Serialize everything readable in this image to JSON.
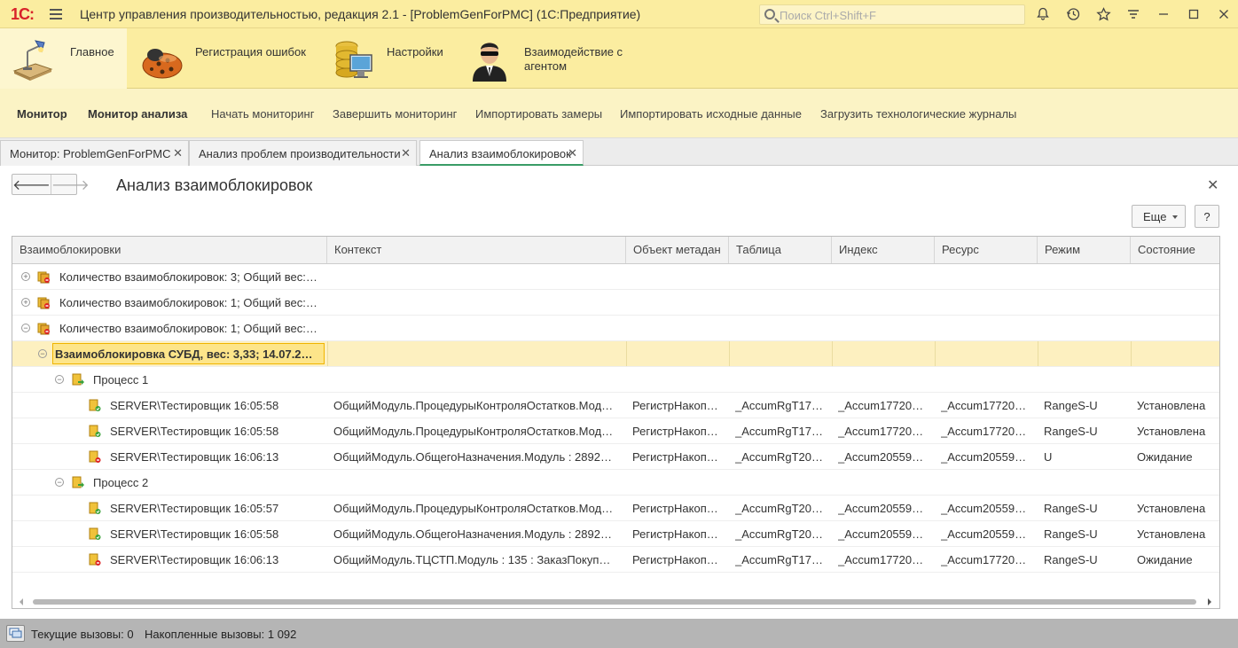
{
  "titlebar": {
    "logo": "1С:",
    "title": "Центр управления производительностью, редакция 2.1 - [ProblemGenForPMC]  (1С:Предприятие)",
    "search_placeholder": "Поиск Ctrl+Shift+F"
  },
  "sections": [
    {
      "label": "Главное",
      "icon": "desk-lamp-icon"
    },
    {
      "label": "Регистрация ошибок",
      "icon": "ladybug-icon"
    },
    {
      "label": "Настройки",
      "icon": "database-monitor-icon"
    },
    {
      "label": "Взаимодействие с агентом",
      "icon": "agent-icon"
    }
  ],
  "functions": [
    {
      "label": "Монитор",
      "bold": true
    },
    {
      "label": "Монитор анализа",
      "bold": true
    },
    {
      "label": "Начать мониторинг",
      "bold": false
    },
    {
      "label": "Завершить мониторинг",
      "bold": false
    },
    {
      "label": "Импортировать замеры",
      "bold": false
    },
    {
      "label": "Импортировать исходные данные",
      "bold": false
    },
    {
      "label": "Загрузить технологические журналы",
      "bold": false
    }
  ],
  "tabs": [
    {
      "label": "Монитор: ProblemGenForPMC",
      "active": false
    },
    {
      "label": "Анализ проблем производительности",
      "active": false
    },
    {
      "label": "Анализ взаимоблокировок",
      "active": true
    }
  ],
  "form": {
    "title": "Анализ взаимоблокировок",
    "more_label": "Еще",
    "help_label": "?"
  },
  "grid": {
    "columns": [
      "Взаимоблокировки",
      "Контекст",
      "Объект метадан",
      "Таблица",
      "Индекс",
      "Ресурс",
      "Режим",
      "Состояние"
    ],
    "rows": [
      {
        "level": 0,
        "toggle": "+",
        "icon": "group",
        "name": "Количество взаимоблокировок: 3; Общий вес:…",
        "cells": [
          "",
          "",
          "",
          "",
          "",
          "",
          ""
        ]
      },
      {
        "level": 0,
        "toggle": "+",
        "icon": "group",
        "name": "Количество взаимоблокировок: 1; Общий вес:…",
        "cells": [
          "",
          "",
          "",
          "",
          "",
          "",
          ""
        ]
      },
      {
        "level": 0,
        "toggle": "−",
        "icon": "group",
        "name": "Количество взаимоблокировок: 1; Общий вес:…",
        "cells": [
          "",
          "",
          "",
          "",
          "",
          "",
          ""
        ]
      },
      {
        "level": 1,
        "toggle": "−",
        "icon": "none",
        "name": "Взаимоблокировка СУБД, вес: 3,33; 14.07.2…",
        "selected": true,
        "cells": [
          "",
          "",
          "",
          "",
          "",
          "",
          ""
        ]
      },
      {
        "level": 2,
        "toggle": "−",
        "icon": "process",
        "name": "Процесс 1",
        "cells": [
          "",
          "",
          "",
          "",
          "",
          "",
          ""
        ]
      },
      {
        "level": 3,
        "toggle": "",
        "icon": "granted",
        "name": "SERVER\\Тестировщик 16:05:58",
        "cells": [
          "ОбщийМодуль.ПроцедурыКонтроляОстатков.Мод…",
          "РегистрНакоп…",
          "_AccumRgT17…",
          "_Accum17720…",
          "_Accum17720…",
          "RangeS-U",
          "Установлена"
        ]
      },
      {
        "level": 3,
        "toggle": "",
        "icon": "granted",
        "name": "SERVER\\Тестировщик 16:05:58",
        "cells": [
          "ОбщийМодуль.ПроцедурыКонтроляОстатков.Мод…",
          "РегистрНакоп…",
          "_AccumRgT17…",
          "_Accum17720…",
          "_Accum17720…",
          "RangeS-U",
          "Установлена"
        ]
      },
      {
        "level": 3,
        "toggle": "",
        "icon": "waiting",
        "name": "SERVER\\Тестировщик 16:06:13",
        "cells": [
          "ОбщийМодуль.ОбщегоНазначения.Модуль : 2892…",
          "РегистрНакоп…",
          "_AccumRgT20…",
          "_Accum20559…",
          "_Accum20559…",
          "U",
          "Ожидание"
        ]
      },
      {
        "level": 2,
        "toggle": "−",
        "icon": "process",
        "name": "Процесс 2",
        "cells": [
          "",
          "",
          "",
          "",
          "",
          "",
          ""
        ]
      },
      {
        "level": 3,
        "toggle": "",
        "icon": "granted",
        "name": "SERVER\\Тестировщик 16:05:57",
        "cells": [
          "ОбщийМодуль.ПроцедурыКонтроляОстатков.Мод…",
          "РегистрНакоп…",
          "_AccumRgT20…",
          "_Accum20559…",
          "_Accum20559…",
          "RangeS-U",
          "Установлена"
        ]
      },
      {
        "level": 3,
        "toggle": "",
        "icon": "granted",
        "name": "SERVER\\Тестировщик 16:05:58",
        "cells": [
          "ОбщийМодуль.ОбщегоНазначения.Модуль : 2892…",
          "РегистрНакоп…",
          "_AccumRgT20…",
          "_Accum20559…",
          "_Accum20559…",
          "RangeS-U",
          "Установлена"
        ]
      },
      {
        "level": 3,
        "toggle": "",
        "icon": "waiting",
        "name": "SERVER\\Тестировщик 16:06:13",
        "cells": [
          "ОбщийМодуль.ТЦСТП.Модуль : 135 : ЗаказПокуп…",
          "РегистрНакоп…",
          "_AccumRgT17…",
          "_Accum17720…",
          "_Accum17720…",
          "RangeS-U",
          "Ожидание"
        ]
      }
    ]
  },
  "status": {
    "current_calls": "Текущие вызовы: 0",
    "accumulated_calls": "Накопленные вызовы: 1 092"
  },
  "colors": {
    "panel_yellow": "#fbeda0",
    "selection_fill": "#fde58a",
    "selection_border": "#f0b400",
    "active_tab_underline": "#3a9c66",
    "logo_red": "#d8232a"
  }
}
